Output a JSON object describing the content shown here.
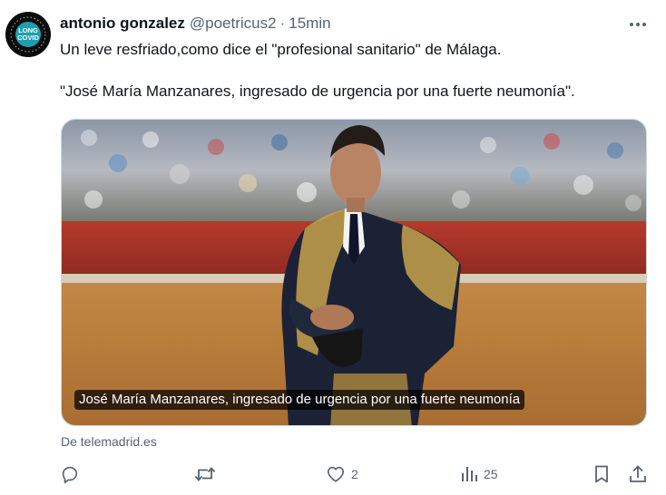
{
  "tweet": {
    "display_name": "antonio gonzalez",
    "handle": "@poetricus2",
    "separator": "·",
    "timestamp": "15min",
    "text_line1": "Un leve resfriado,como dice el \"profesional sanitario\" de Málaga.",
    "text_line2": "\"José María Manzanares, ingresado de urgencia por una fuerte neumonía\"."
  },
  "avatar": {
    "logo_text_top": "LONG",
    "logo_text_bottom": "COVID"
  },
  "media": {
    "caption": "José María Manzanares, ingresado de urgencia por una fuerte neumonía",
    "source": "De telemadrid.es"
  },
  "actions": {
    "reply_count": "",
    "retweet_count": "",
    "like_count": "2",
    "views_count": "25"
  },
  "colors": {
    "secondary_text": "#536471",
    "primary_text": "#0f1419",
    "card_border": "#cfd9de"
  }
}
